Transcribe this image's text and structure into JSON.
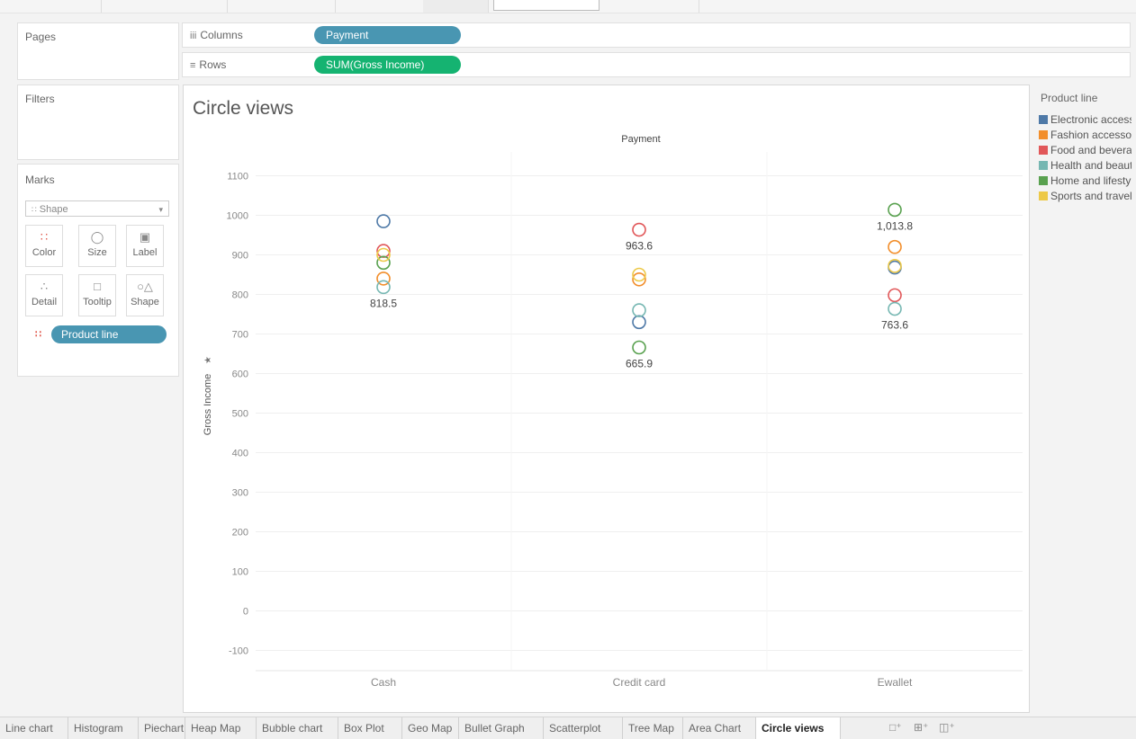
{
  "shelves": {
    "columns_label": "Columns",
    "columns_pill": "Payment",
    "rows_label": "Rows",
    "rows_pill": "SUM(Gross Income)"
  },
  "side": {
    "pages_title": "Pages",
    "filters_title": "Filters",
    "marks_title": "Marks",
    "mark_type": "Shape",
    "buttons": [
      "Color",
      "Size",
      "Label",
      "Detail",
      "Tooltip",
      "Shape"
    ],
    "marks_pill": "Product line"
  },
  "view": {
    "title": "Circle views"
  },
  "legend": {
    "title": "Product line",
    "items": [
      {
        "label": "Electronic accessories",
        "color": "#4e79a7"
      },
      {
        "label": "Fashion accessories",
        "color": "#f28e2b"
      },
      {
        "label": "Food and beverages",
        "color": "#e15759"
      },
      {
        "label": "Health and beauty",
        "color": "#76b7b2"
      },
      {
        "label": "Home and lifestyle",
        "color": "#59a14f"
      },
      {
        "label": "Sports and travel",
        "color": "#edc948"
      }
    ]
  },
  "tabs": [
    "Line chart",
    "Histogram",
    "Piechart",
    "Heap Map",
    "Bubble chart",
    "Box Plot",
    "Geo Map",
    "Bullet Graph",
    "Scatterplot",
    "Tree Map",
    "Area Chart",
    "Circle views"
  ],
  "active_tab": "Circle views",
  "chart_data": {
    "type": "scatter",
    "title": "Payment",
    "xlabel": "",
    "ylabel": "Gross Income",
    "categories": [
      "Cash",
      "Credit card",
      "Ewallet"
    ],
    "ylim": [
      -100,
      1100
    ],
    "yticks": [
      -100,
      0,
      100,
      200,
      300,
      400,
      500,
      600,
      700,
      800,
      900,
      1000,
      1100
    ],
    "grid": true,
    "legend_position": "right",
    "series": [
      {
        "color": "#4e79a7",
        "values": [
          985,
          730,
          868
        ]
      },
      {
        "color": "#f28e2b",
        "values": [
          840,
          838,
          920
        ]
      },
      {
        "color": "#e15759",
        "values": [
          910,
          963.6,
          798
        ]
      },
      {
        "color": "#76b7b2",
        "values": [
          818.5,
          760,
          763.6
        ]
      },
      {
        "color": "#59a14f",
        "values": [
          880,
          665.9,
          1013.8
        ]
      },
      {
        "color": "#edc948",
        "values": [
          900,
          850,
          872
        ]
      }
    ],
    "data_labels": [
      {
        "category": "Cash",
        "value": 818.5,
        "text": "818.5"
      },
      {
        "category": "Credit card",
        "value": 963.6,
        "text": "963.6"
      },
      {
        "category": "Credit card",
        "value": 665.9,
        "text": "665.9"
      },
      {
        "category": "Ewallet",
        "value": 1013.8,
        "text": "1,013.8"
      },
      {
        "category": "Ewallet",
        "value": 763.6,
        "text": "763.6"
      }
    ]
  }
}
